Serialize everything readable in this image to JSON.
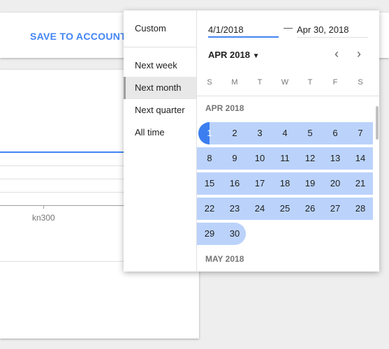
{
  "toolbar": {
    "save_label": "SAVE TO ACCOUNT"
  },
  "chart": {
    "tick_label": "kn300",
    "line_color": "#4285f4"
  },
  "picker": {
    "presets": [
      {
        "label": "Custom"
      },
      {
        "label": "Next week"
      },
      {
        "label": "Next month",
        "selected": true
      },
      {
        "label": "Next quarter"
      },
      {
        "label": "All time"
      }
    ],
    "start_value": "4/1/2018",
    "end_value": "Apr 30, 2018",
    "separator": "—",
    "month_header": "APR 2018",
    "weekdays": [
      "S",
      "M",
      "T",
      "W",
      "T",
      "F",
      "S"
    ],
    "month_label": "APR 2018",
    "next_month_label": "MAY 2018",
    "accent": "#3b7ef0",
    "range_color": "#bbd3fb"
  }
}
